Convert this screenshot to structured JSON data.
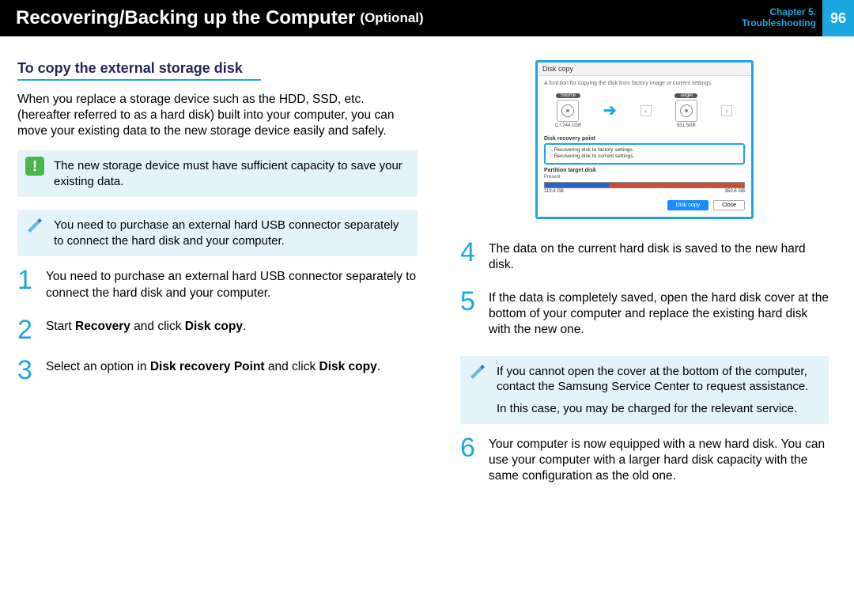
{
  "header": {
    "title": "Recovering/Backing up the Computer",
    "subtitle": "(Optional)",
    "chapter": "Chapter 5.",
    "breadcrumb": "Troubleshooting",
    "page": "96"
  },
  "section_title": "To copy the external storage disk",
  "intro": "When you replace a storage device such as the HDD, SSD, etc. (hereafter referred to as a hard disk) built into your computer, you can move your existing data to the new storage device easily and safely.",
  "callout_warn": "The new storage device must have sufficient capacity to save your existing data.",
  "callout_note_left": "You need to purchase an external hard USB connector separately to connect the hard disk and your computer.",
  "steps_left": [
    {
      "n": "1",
      "text": "You need to purchase an external hard USB connector separately to connect the hard disk and your computer."
    },
    {
      "n": "2",
      "prefix": "Start ",
      "b1": "Recovery",
      "mid": " and click ",
      "b2": "Disk copy",
      "suffix": "."
    },
    {
      "n": "3",
      "prefix": "Select an option in ",
      "b1": "Disk recovery Point",
      "mid": " and click ",
      "b2": "Disk copy",
      "suffix": "."
    }
  ],
  "diskcopy": {
    "title": "Disk copy",
    "desc": "A function for copying the disk from factory image or current settings.",
    "source_label": "Source",
    "target_label": "Target",
    "source_cap": "C:\\ 244.1GB",
    "target_cap": "931.5GB",
    "recovery_title": "Disk recovery point",
    "recovery_opt1": "Recovering disk to factory settings.",
    "recovery_opt2": "Recovering disk to current settings.",
    "partition_title": "Partition target disk",
    "present_label": "Present",
    "free_cap": "119.6 GB",
    "used_cap": "350.6 GB",
    "btn_copy": "Disk copy",
    "btn_close": "Close"
  },
  "steps_right": [
    {
      "n": "4",
      "text": "The data on the current hard disk is saved to the new hard disk."
    },
    {
      "n": "5",
      "text": "If the data is completely saved, open the hard disk cover at the bottom of your computer and replace the existing hard disk with the new one."
    }
  ],
  "callout_note_right_l1": "If you cannot open the cover at the bottom of the computer, contact the Samsung Service Center to request assistance.",
  "callout_note_right_l2": "In this case, you may be charged for the relevant service.",
  "step6": {
    "n": "6",
    "text": "Your computer is now equipped with a new hard disk. You can use your computer with a larger hard disk capacity with the same configuration as the old one."
  }
}
